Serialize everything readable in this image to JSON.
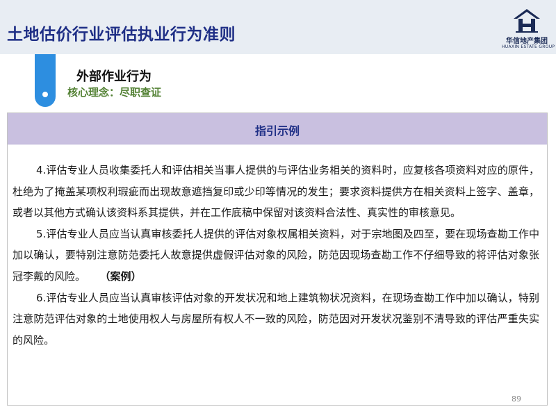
{
  "header": {
    "title": "土地估价行业评估执业行为准则"
  },
  "logo": {
    "name_cn": "华信地产集团",
    "name_en": "HUAXIN ESTATE GROUP",
    "brand_color": "#1a2a55"
  },
  "section": {
    "title": "外部作业行为",
    "core_concept": "核心理念：尽职查证",
    "accent_color": "#2d8ee0",
    "concept_color": "#548235"
  },
  "panel": {
    "header": "指引示例",
    "header_bg": "#c9c0e0",
    "paragraphs": [
      {
        "text": "4.评估专业人员收集委托人和评估相关当事人提供的与评估业务相关的资料时，应复核各项资料对应的原件，杜绝为了掩盖某项权利瑕疵而出现故意遮挡复印或少印等情况的发生；要求资料提供方在相关资料上签字、盖章，或者以其他方式确认该资料系其提供，并在工作底稿中保留对该资料合法性、真实性的审核意见。"
      },
      {
        "text": "5.评估专业人员应当认真审核委托人提供的评估对象权属相关资料，对于宗地图及四至，要在现场查勘工作中加以确认，要特别注意防范委托人故意提供虚假评估对象的风险，防范因现场查勘工作不仔细导致的将评估对象张冠李戴的风险。",
        "tag": "（案例）"
      },
      {
        "text": "6.评估专业人员应当认真审核评估对象的开发状况和地上建筑物状况资料，在现场查勘工作中加以确认，特别注意防范评估对象的土地使用权人与房屋所有权人不一致的风险，防范因对开发状况鉴别不清导致的评估严重失实的风险。"
      }
    ]
  },
  "footer": {
    "page_number": "89"
  }
}
